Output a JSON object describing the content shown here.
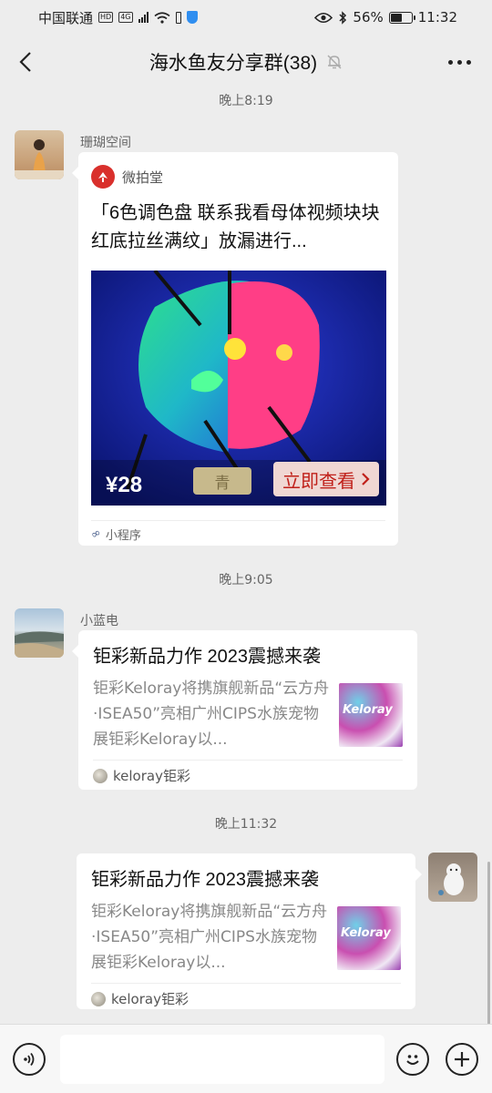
{
  "status_bar": {
    "carrier": "中国联通",
    "hd_badge": "HD",
    "net_badge": "4G",
    "battery_percent": "56%",
    "battery_level": 0.56,
    "time": "11:32"
  },
  "header": {
    "title": "海水鱼友分享群(38)",
    "icons": {
      "back": "chevron-left-icon",
      "mute": "mute-bell-icon",
      "more": "more-dots-icon"
    }
  },
  "messages": [
    {
      "time": "晚上8:19",
      "sender": "珊瑚空间",
      "card": {
        "kind": "mini-program",
        "source": "微拍堂",
        "title": "「6色调色盘 联系我看母体视频块块红底拉丝满纹」放漏进行...",
        "price": "¥28",
        "tag": "青",
        "cta": "立即查看",
        "footer": "小程序"
      }
    },
    {
      "time": "晚上9:05",
      "sender": "小蓝电",
      "card": {
        "kind": "link",
        "title": "钜彩新品力作 2023震撼来袭",
        "description": "钜彩Keloray将携旗舰新品“云方舟·ISEA50”亮相广州CIPS水族宠物展钜彩Keloray以...",
        "thumb_text": "Keloray",
        "source": "keloray钜彩"
      }
    },
    {
      "time": "晚上11:32",
      "sender": "",
      "card": {
        "kind": "link",
        "title": "钜彩新品力作 2023震撼来袭",
        "description": "钜彩Keloray将携旗舰新品“云方舟·ISEA50”亮相广州CIPS水族宠物展钜彩Keloray以...",
        "thumb_text": "Keloray",
        "source": "keloray钜彩"
      }
    }
  ],
  "input_bar": {
    "placeholder": "",
    "icons": {
      "voice": "voice-icon",
      "emoji": "emoji-icon",
      "plus": "plus-icon"
    }
  },
  "colors": {
    "background": "#ededed",
    "bubble": "#ffffff",
    "mini_program_brand": "#d9302c",
    "cta_text": "#c0201a"
  }
}
